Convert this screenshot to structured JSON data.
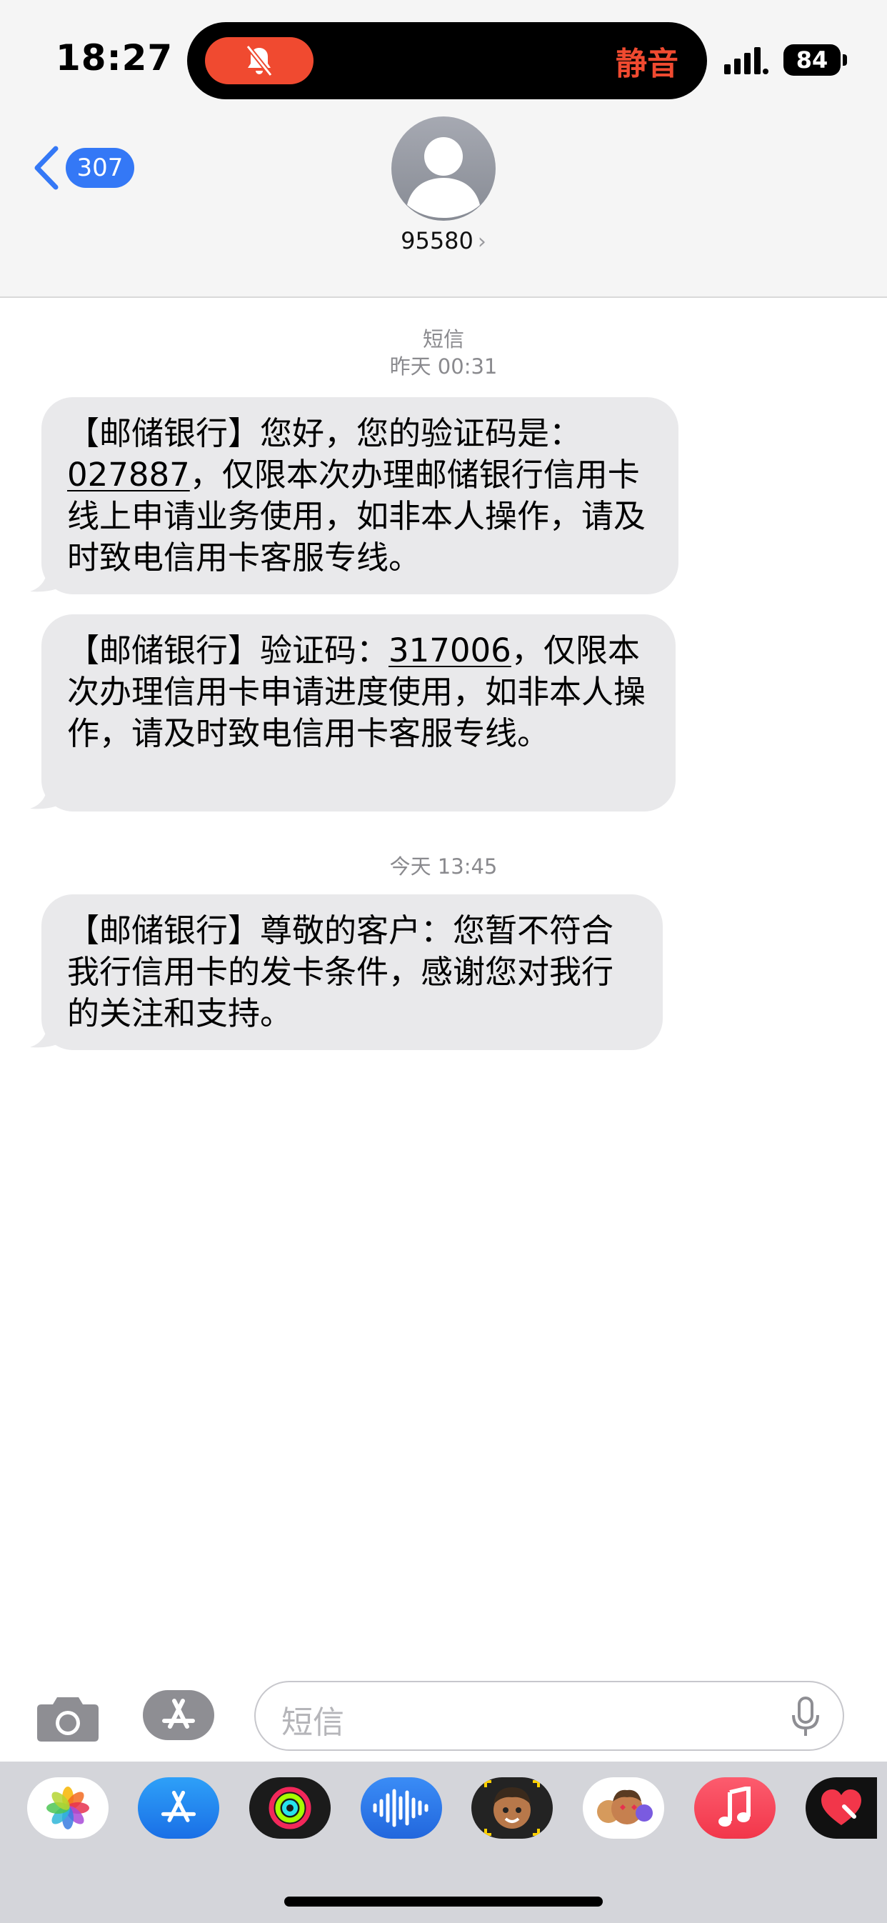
{
  "status_bar": {
    "time": "18:27",
    "mute_label": "静音",
    "battery": "84"
  },
  "nav": {
    "back_count": "307",
    "contact_name": "95580",
    "contact_chevron": "›"
  },
  "thread": {
    "header_service": "短信",
    "header_time_1": "昨天 00:31",
    "header_time_2": "今天 13:45",
    "messages": [
      {
        "before": "【邮储银行】您好，您的验证码是：",
        "code": "027887",
        "after": "，仅限本次办理邮储银行信用卡线上申请业务使用，如非本人操作，请及时致电信用卡客服专线。"
      },
      {
        "before": "【邮储银行】验证码：",
        "code": "317006",
        "after": "，仅限本次办理信用卡申请进度使用，如非本人操作，请及时致电信用卡客服专线。"
      },
      {
        "text": "【邮储银行】尊敬的客户：您暂不符合我行信用卡的发卡条件，感谢您对我行的关注和支持。"
      }
    ]
  },
  "composer": {
    "placeholder": "短信"
  },
  "tray": {
    "apps": [
      "photos-icon",
      "app-store-icon",
      "fitness-icon",
      "audio-message-icon",
      "memoji-icon",
      "memoji-stickers-icon",
      "music-icon",
      "heart-sticker-icon"
    ]
  },
  "colors": {
    "accent": "#3478f6",
    "mute": "#f04a30",
    "bubble": "#e9e9eb"
  }
}
